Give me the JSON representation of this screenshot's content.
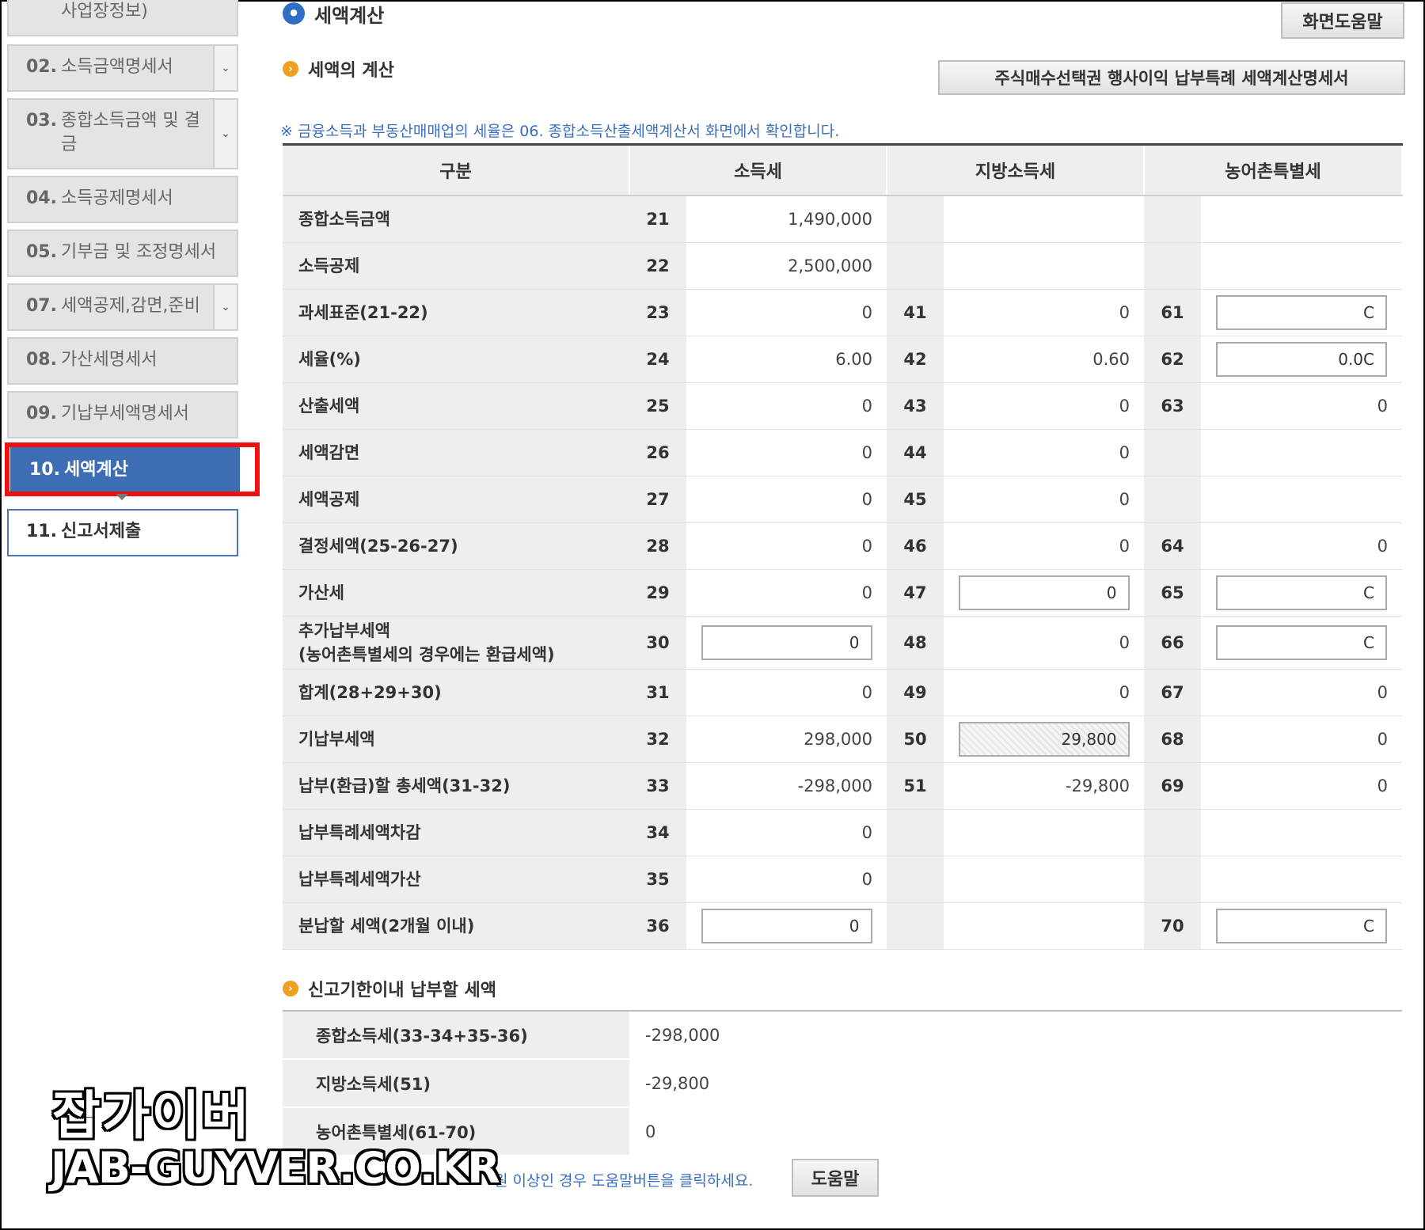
{
  "sidebar": {
    "items": [
      {
        "num": "",
        "label": "사업장정보)",
        "dropdown": false
      },
      {
        "num": "02.",
        "label": "소득금액명세서",
        "dropdown": true
      },
      {
        "num": "03.",
        "label": "종합소득금액 및 결",
        "label2": "금",
        "dropdown": true
      },
      {
        "num": "04.",
        "label": "소득공제명세서",
        "dropdown": false
      },
      {
        "num": "05.",
        "label": "기부금 및 조정명세서",
        "dropdown": false
      },
      {
        "num": "07.",
        "label": "세액공제,감면,준비",
        "dropdown": true
      },
      {
        "num": "08.",
        "label": "가산세명세서",
        "dropdown": false
      },
      {
        "num": "09.",
        "label": "기납부세액명세서",
        "dropdown": false
      },
      {
        "num": "10.",
        "label": "세액계산",
        "dropdown": false,
        "state": "active"
      },
      {
        "num": "11.",
        "label": "신고서제출",
        "dropdown": false,
        "state": "next"
      }
    ]
  },
  "header": {
    "page_title": "세액계산",
    "help_button": "화면도움말",
    "section_title": "세액의 계산",
    "stock_option_button": "주식매수선택권 행사이익 납부특례 세액계산명세서",
    "notice": "※ 금융소득과 부동산매매업의 세율은 06. 종합소득산출세액계산서 화면에서 확인합니다."
  },
  "table": {
    "headers": [
      "구분",
      "소득세",
      "지방소득세",
      "농어촌특별세"
    ],
    "rows": [
      {
        "label": "종합소득금액",
        "c1": "21",
        "v1": "1,490,000",
        "c2": "",
        "v2": "",
        "c3": "",
        "v3": ""
      },
      {
        "label": "소득공제",
        "c1": "22",
        "v1": "2,500,000",
        "c2": "",
        "v2": "",
        "c3": "",
        "v3": ""
      },
      {
        "label": "과세표준(21-22)",
        "c1": "23",
        "v1": "0",
        "c2": "41",
        "v2": "0",
        "c3": "61",
        "v3": "C",
        "v3_input": true
      },
      {
        "label": "세율(%)",
        "c1": "24",
        "v1": "6.00",
        "c2": "42",
        "v2": "0.60",
        "c3": "62",
        "v3": "0.0C",
        "v3_input": true
      },
      {
        "label": "산출세액",
        "c1": "25",
        "v1": "0",
        "c2": "43",
        "v2": "0",
        "c3": "63",
        "v3": "0"
      },
      {
        "label": "세액감면",
        "c1": "26",
        "v1": "0",
        "c2": "44",
        "v2": "0",
        "c3": "",
        "v3": ""
      },
      {
        "label": "세액공제",
        "c1": "27",
        "v1": "0",
        "c2": "45",
        "v2": "0",
        "c3": "",
        "v3": ""
      },
      {
        "label": "결정세액(25-26-27)",
        "c1": "28",
        "v1": "0",
        "c2": "46",
        "v2": "0",
        "c3": "64",
        "v3": "0"
      },
      {
        "label": "가산세",
        "c1": "29",
        "v1": "0",
        "c2": "47",
        "v2": "0",
        "v2_input": true,
        "c3": "65",
        "v3": "C",
        "v3_input": true
      },
      {
        "label": "추가납부세액",
        "label2": "(농어촌특별세의 경우에는 환급세액)",
        "c1": "30",
        "v1": "0",
        "v1_input": true,
        "c2": "48",
        "v2": "0",
        "c3": "66",
        "v3": "C",
        "v3_input": true
      },
      {
        "label": "합계(28+29+30)",
        "c1": "31",
        "v1": "0",
        "c2": "49",
        "v2": "0",
        "c3": "67",
        "v3": "0"
      },
      {
        "label": "기납부세액",
        "c1": "32",
        "v1": "298,000",
        "c2": "50",
        "v2": "29,800",
        "v2_input": true,
        "v2_readonly": true,
        "c3": "68",
        "v3": "0"
      },
      {
        "label": "납부(환급)할 총세액(31-32)",
        "c1": "33",
        "v1": "-298,000",
        "c2": "51",
        "v2": "-29,800",
        "c3": "69",
        "v3": "0"
      },
      {
        "label": "납부특례세액차감",
        "c1": "34",
        "v1": "0",
        "c2": "",
        "v2": "",
        "c3": "",
        "v3": ""
      },
      {
        "label": "납부특례세액가산",
        "c1": "35",
        "v1": "0",
        "c2": "",
        "v2": "",
        "c3": "",
        "v3": ""
      },
      {
        "label": "분납할 세액(2개월 이내)",
        "c1": "36",
        "v1": "0",
        "v1_input": true,
        "c2": "",
        "v2": "",
        "c3": "70",
        "v3": "C",
        "v3_input": true
      }
    ]
  },
  "deadline": {
    "section_title": "신고기한이내 납부할 세액",
    "rows": [
      {
        "label": "종합소득세(33-34+35-36)",
        "value": "-298,000"
      },
      {
        "label": "지방소득세(51)",
        "value": "-29,800"
      },
      {
        "label": "농어촌특별세(61-70)",
        "value": "0"
      }
    ],
    "note_visible": "원 이상인 경우 도움말버튼을 클릭하세요.",
    "help_button": "도움말"
  },
  "watermark": {
    "korean": "잡가이버",
    "url": "JAB-GUYVER.CO.KR"
  },
  "colors": {
    "active_menu": "#3d6db3",
    "highlight_box": "#ee1111",
    "notice_text": "#3a6fc2",
    "section_bullet": "#f0a020",
    "title_bullet": "#2f6ec3"
  }
}
